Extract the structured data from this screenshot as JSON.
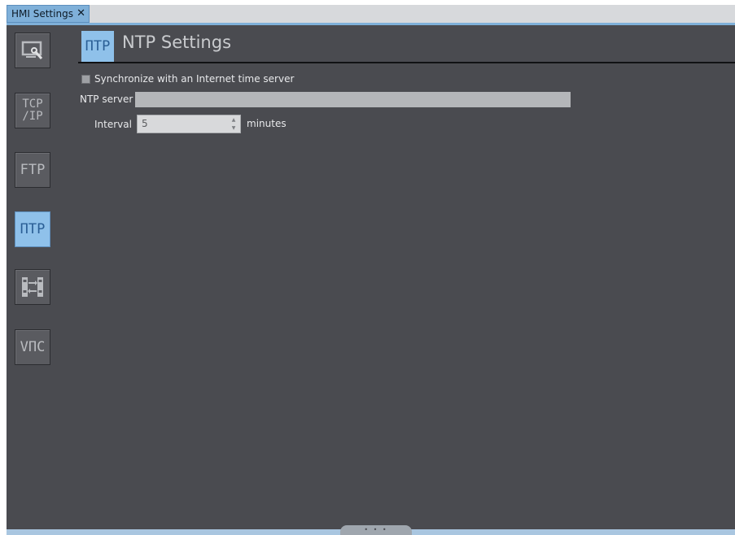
{
  "tab": {
    "title": "HMI Settings",
    "close_glyph": "✕"
  },
  "sidebar": {
    "items": [
      {
        "id": "display",
        "icon": "monitor-settings-icon",
        "label": ""
      },
      {
        "id": "tcpip",
        "icon": "tcpip-icon",
        "label_line1": "TCP",
        "label_line2": "/IP"
      },
      {
        "id": "ftp",
        "icon": "ftp-icon",
        "label": "FTP"
      },
      {
        "id": "ntp",
        "icon": "ntp-icon",
        "label": "ΠΤΡ",
        "active": true
      },
      {
        "id": "transfer",
        "icon": "transfer-icon",
        "label": ""
      },
      {
        "id": "vnc",
        "icon": "vnc-icon",
        "label": "VΠC"
      }
    ]
  },
  "header": {
    "icon_text": "ΠΤΡ",
    "title": "NTP Settings"
  },
  "form": {
    "sync_label": "Synchronize with an Internet time server",
    "sync_checked": false,
    "ntp_server_label": "NTP server",
    "ntp_server_value": "",
    "interval_label": "Interval",
    "interval_value": "5",
    "minutes_label": "minutes",
    "spin_up": "▲",
    "spin_down": "▼"
  },
  "splitter": {
    "grip": "• • •"
  },
  "colors": {
    "accent": "#7fb0d9",
    "panel_bg": "#4a4b50",
    "active_icon_bg": "#8fc1ea"
  }
}
